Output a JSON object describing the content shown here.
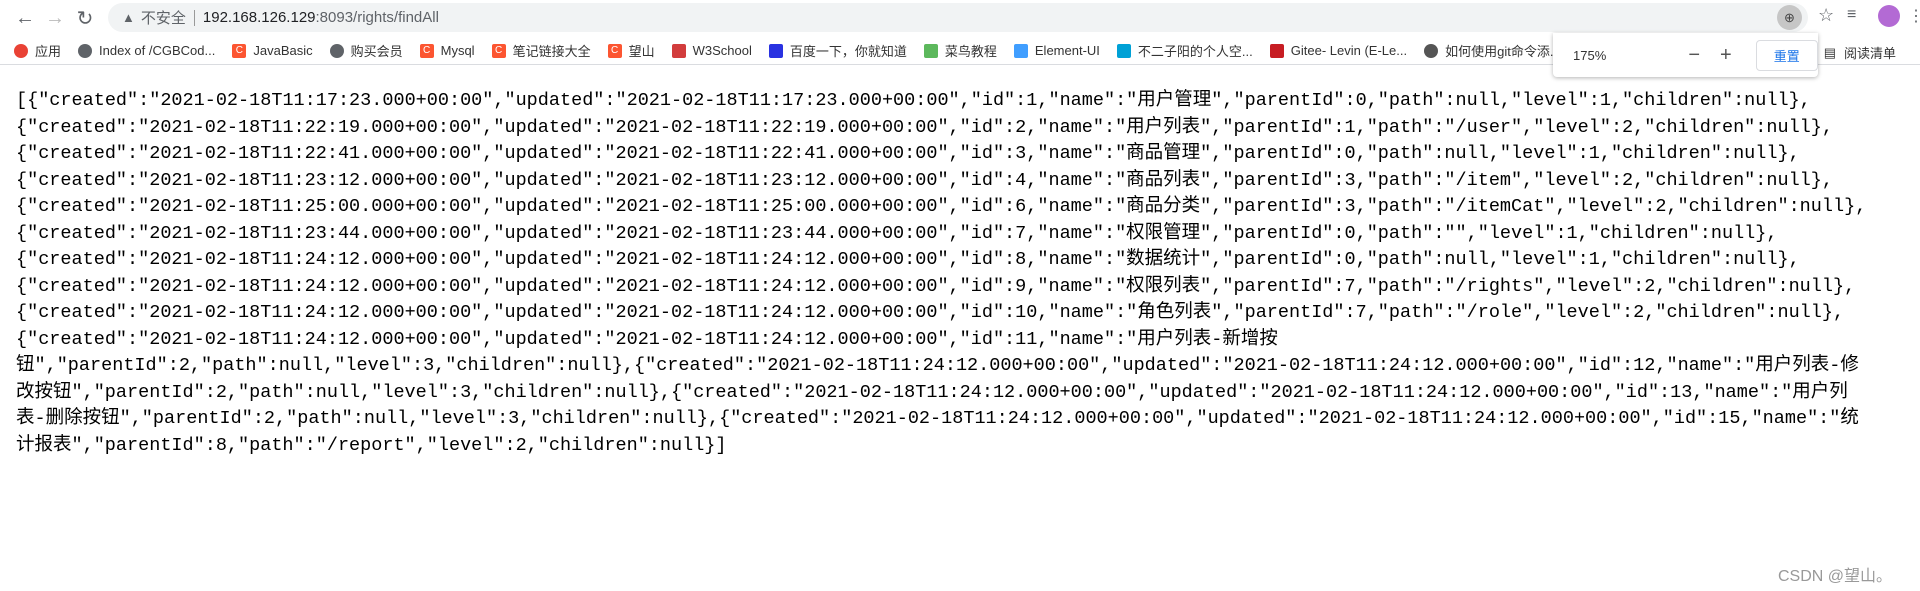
{
  "browser": {
    "security_label": "不安全",
    "url_host": "192.168.126.129",
    "url_rest": ":8093/rights/findAll",
    "icons": [
      "back-icon",
      "forward-icon",
      "reload-icon",
      "warning-icon",
      "zoom-icon",
      "star-icon",
      "media-icon",
      "avatar",
      "menu-icon"
    ]
  },
  "bookmarks": [
    {
      "label": "应用",
      "icon": "apps-icon",
      "color": "#e94235"
    },
    {
      "label": "Index of /CGBCod...",
      "icon": "globe-icon",
      "color": "#5f6368"
    },
    {
      "label": "JavaBasic",
      "icon": "c-icon",
      "color": "#fc5531"
    },
    {
      "label": "购买会员",
      "icon": "globe-icon",
      "color": "#5f6368"
    },
    {
      "label": "Mysql",
      "icon": "c-icon",
      "color": "#fc5531"
    },
    {
      "label": "笔记链接大全",
      "icon": "c-icon",
      "color": "#fc5531"
    },
    {
      "label": "望山",
      "icon": "c-icon",
      "color": "#fc5531"
    },
    {
      "label": "W3School",
      "icon": "w3-icon",
      "color": "#d23c3c"
    },
    {
      "label": "百度一下，你就知道",
      "icon": "baidu-icon",
      "color": "#2932e1"
    },
    {
      "label": "菜鸟教程",
      "icon": "runoob-icon",
      "color": "#5cb85c"
    },
    {
      "label": "Element-UI",
      "icon": "element-icon",
      "color": "#409eff"
    },
    {
      "label": "不二子阳的个人空...",
      "icon": "bilibili-icon",
      "color": "#00a1d6"
    },
    {
      "label": "Gitee- Levin (E-Le...",
      "icon": "gitee-icon",
      "color": "#c71d23"
    },
    {
      "label": "如何使用git命令添...",
      "icon": "pen-icon",
      "color": "#555555"
    }
  ],
  "reading_list": "阅读清单",
  "zoom_popup": {
    "value": "175%",
    "minus": "−",
    "plus": "+",
    "reset": "重置"
  },
  "body_text": "[{\"created\":\"2021-02-18T11:17:23.000+00:00\",\"updated\":\"2021-02-18T11:17:23.000+00:00\",\"id\":1,\"name\":\"用户管理\",\"parentId\":0,\"path\":null,\"level\":1,\"children\":null},{\"created\":\"2021-02-18T11:22:19.000+00:00\",\"updated\":\"2021-02-18T11:22:19.000+00:00\",\"id\":2,\"name\":\"用户列表\",\"parentId\":1,\"path\":\"/user\",\"level\":2,\"children\":null},{\"created\":\"2021-02-18T11:22:41.000+00:00\",\"updated\":\"2021-02-18T11:22:41.000+00:00\",\"id\":3,\"name\":\"商品管理\",\"parentId\":0,\"path\":null,\"level\":1,\"children\":null},{\"created\":\"2021-02-18T11:23:12.000+00:00\",\"updated\":\"2021-02-18T11:23:12.000+00:00\",\"id\":4,\"name\":\"商品列表\",\"parentId\":3,\"path\":\"/item\",\"level\":2,\"children\":null},{\"created\":\"2021-02-18T11:25:00.000+00:00\",\"updated\":\"2021-02-18T11:25:00.000+00:00\",\"id\":6,\"name\":\"商品分类\",\"parentId\":3,\"path\":\"/itemCat\",\"level\":2,\"children\":null},{\"created\":\"2021-02-18T11:23:44.000+00:00\",\"updated\":\"2021-02-18T11:23:44.000+00:00\",\"id\":7,\"name\":\"权限管理\",\"parentId\":0,\"path\":\"\",\"level\":1,\"children\":null},{\"created\":\"2021-02-18T11:24:12.000+00:00\",\"updated\":\"2021-02-18T11:24:12.000+00:00\",\"id\":8,\"name\":\"数据统计\",\"parentId\":0,\"path\":null,\"level\":1,\"children\":null},{\"created\":\"2021-02-18T11:24:12.000+00:00\",\"updated\":\"2021-02-18T11:24:12.000+00:00\",\"id\":9,\"name\":\"权限列表\",\"parentId\":7,\"path\":\"/rights\",\"level\":2,\"children\":null},{\"created\":\"2021-02-18T11:24:12.000+00:00\",\"updated\":\"2021-02-18T11:24:12.000+00:00\",\"id\":10,\"name\":\"角色列表\",\"parentId\":7,\"path\":\"/role\",\"level\":2,\"children\":null},{\"created\":\"2021-02-18T11:24:12.000+00:00\",\"updated\":\"2021-02-18T11:24:12.000+00:00\",\"id\":11,\"name\":\"用户列表-新增按钮\",\"parentId\":2,\"path\":null,\"level\":3,\"children\":null},{\"created\":\"2021-02-18T11:24:12.000+00:00\",\"updated\":\"2021-02-18T11:24:12.000+00:00\",\"id\":12,\"name\":\"用户列表-修改按钮\",\"parentId\":2,\"path\":null,\"level\":3,\"children\":null},{\"created\":\"2021-02-18T11:24:12.000+00:00\",\"updated\":\"2021-02-18T11:24:12.000+00:00\",\"id\":13,\"name\":\"用户列表-删除按钮\",\"parentId\":2,\"path\":null,\"level\":3,\"children\":null},{\"created\":\"2021-02-18T11:24:12.000+00:00\",\"updated\":\"2021-02-18T11:24:12.000+00:00\",\"id\":15,\"name\":\"统计报表\",\"parentId\":8,\"path\":\"/report\",\"level\":2,\"children\":null}]",
  "watermark": "CSDN @望山。"
}
